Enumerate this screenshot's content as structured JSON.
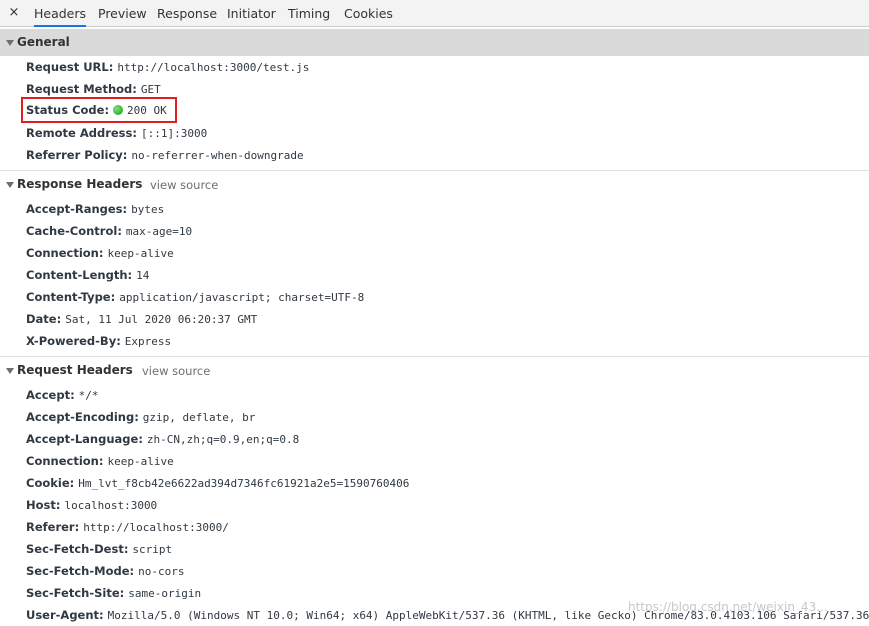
{
  "tabs": {
    "close": "×",
    "items": [
      {
        "label": "Headers"
      },
      {
        "label": "Preview"
      },
      {
        "label": "Response"
      },
      {
        "label": "Initiator"
      },
      {
        "label": "Timing"
      },
      {
        "label": "Cookies"
      }
    ]
  },
  "general": {
    "title": "General",
    "rows": [
      {
        "key": "Request URL:",
        "value": "http://localhost:3000/test.js"
      },
      {
        "key": "Request Method:",
        "value": "GET"
      },
      {
        "key": "Status Code:",
        "value": "200 OK"
      },
      {
        "key": "Remote Address:",
        "value": "[::1]:3000"
      },
      {
        "key": "Referrer Policy:",
        "value": "no-referrer-when-downgrade"
      }
    ]
  },
  "response_headers": {
    "title": "Response Headers",
    "view_source": "view source",
    "rows": [
      {
        "key": "Accept-Ranges:",
        "value": "bytes"
      },
      {
        "key": "Cache-Control:",
        "value": "max-age=10"
      },
      {
        "key": "Connection:",
        "value": "keep-alive"
      },
      {
        "key": "Content-Length:",
        "value": "14"
      },
      {
        "key": "Content-Type:",
        "value": "application/javascript; charset=UTF-8"
      },
      {
        "key": "Date:",
        "value": "Sat, 11 Jul 2020 06:20:37 GMT"
      },
      {
        "key": "X-Powered-By:",
        "value": "Express"
      }
    ]
  },
  "request_headers": {
    "title": "Request Headers",
    "view_source": "view source",
    "rows": [
      {
        "key": "Accept:",
        "value": "*/*"
      },
      {
        "key": "Accept-Encoding:",
        "value": "gzip, deflate, br"
      },
      {
        "key": "Accept-Language:",
        "value": "zh-CN,zh;q=0.9,en;q=0.8"
      },
      {
        "key": "Connection:",
        "value": "keep-alive"
      },
      {
        "key": "Cookie:",
        "value": "Hm_lvt_f8cb42e6622ad394d7346fc61921a2e5=1590760406"
      },
      {
        "key": "Host:",
        "value": "localhost:3000"
      },
      {
        "key": "Referer:",
        "value": "http://localhost:3000/"
      },
      {
        "key": "Sec-Fetch-Dest:",
        "value": "script"
      },
      {
        "key": "Sec-Fetch-Mode:",
        "value": "no-cors"
      },
      {
        "key": "Sec-Fetch-Site:",
        "value": "same-origin"
      },
      {
        "key": "User-Agent:",
        "value": "Mozilla/5.0 (Windows NT 10.0; Win64; x64) AppleWebKit/537.36 (KHTML, like Gecko) Chrome/83.0.4103.106 Safari/537.36"
      }
    ]
  },
  "watermark": "https://blog.csdn.net/weixin_43...",
  "colors": {
    "status_ok": "#0d9e0d",
    "highlight_box": "#e0201f",
    "active_tab_underline": "#1a73e8"
  }
}
